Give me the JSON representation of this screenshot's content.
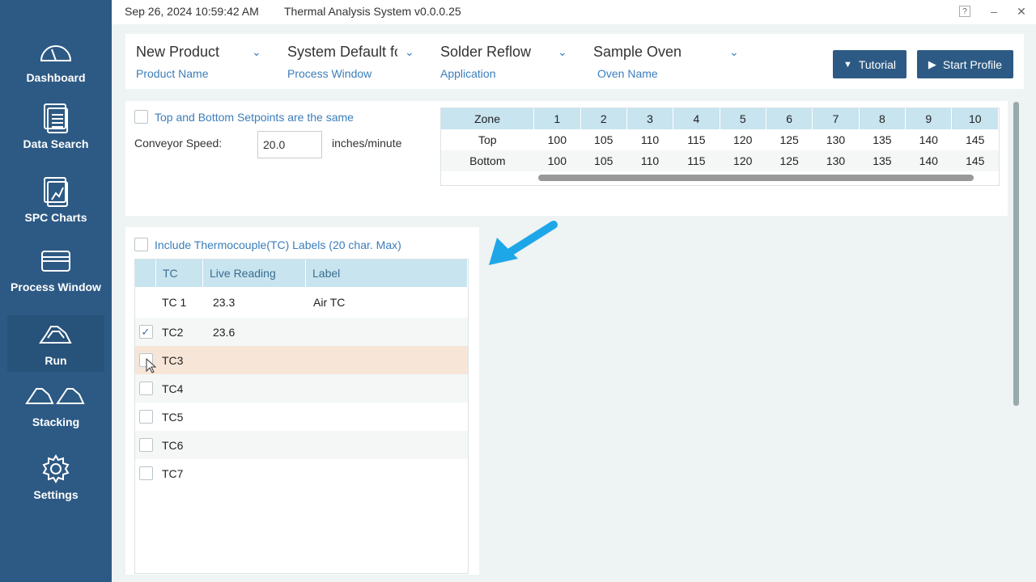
{
  "window": {
    "datetime": "Sep 26, 2024 10:59:42 AM",
    "title": "Thermal Analysis System v0.0.0.25",
    "help_label": "?",
    "minimize_label": "–",
    "close_label": "✕"
  },
  "sidebar": {
    "items": [
      {
        "label": "Dashboard",
        "icon": "gauge-icon"
      },
      {
        "label": "Data Search",
        "icon": "documents-icon"
      },
      {
        "label": "SPC Charts",
        "icon": "chart-clipboard-icon"
      },
      {
        "label": "Process Window",
        "icon": "window-icon"
      },
      {
        "label": "Run",
        "icon": "profile-icon",
        "active": true
      },
      {
        "label": "Stacking",
        "icon": "stacking-icon"
      },
      {
        "label": "Settings",
        "icon": "gear-icon"
      }
    ]
  },
  "header": {
    "product": {
      "value": "New Product",
      "label": "Product Name"
    },
    "process_window": {
      "value": "System Default fo",
      "label": "Process Window"
    },
    "application": {
      "value": "Solder Reflow",
      "label": "Application"
    },
    "oven": {
      "value": "Sample Oven",
      "label": "Oven Name"
    },
    "tutorial_label": "Tutorial",
    "start_label": "Start Profile"
  },
  "setpoints": {
    "same_label": "Top and Bottom Setpoints are the same",
    "same_checked": false,
    "conveyor_label": "Conveyor Speed:",
    "conveyor_value": "20.0",
    "conveyor_unit": "inches/minute",
    "zone_table": {
      "header": [
        "Zone",
        "1",
        "2",
        "3",
        "4",
        "5",
        "6",
        "7",
        "8",
        "9",
        "10"
      ],
      "rows": [
        [
          "Top",
          "100",
          "105",
          "110",
          "115",
          "120",
          "125",
          "130",
          "135",
          "140",
          "145"
        ],
        [
          "Bottom",
          "100",
          "105",
          "110",
          "115",
          "120",
          "125",
          "130",
          "135",
          "140",
          "145"
        ]
      ]
    }
  },
  "tc": {
    "include_label": "Include Thermocouple(TC)  Labels (20 char. Max)",
    "columns": [
      "TC",
      "Live Reading",
      "Label"
    ],
    "rows": [
      {
        "tc": "TC 1",
        "reading": "23.3",
        "label": "Air TC",
        "checkbox": false,
        "checked": false
      },
      {
        "tc": "TC2",
        "reading": "23.6",
        "label": "",
        "checkbox": true,
        "checked": true
      },
      {
        "tc": "TC3",
        "reading": "",
        "label": "",
        "checkbox": true,
        "checked": false,
        "hover": true
      },
      {
        "tc": "TC4",
        "reading": "",
        "label": "",
        "checkbox": true,
        "checked": false
      },
      {
        "tc": "TC5",
        "reading": "",
        "label": "",
        "checkbox": true,
        "checked": false
      },
      {
        "tc": "TC6",
        "reading": "",
        "label": "",
        "checkbox": true,
        "checked": false
      },
      {
        "tc": "TC7",
        "reading": "",
        "label": "",
        "checkbox": true,
        "checked": false
      }
    ]
  },
  "colors": {
    "sidebar": "#2d5a84",
    "accent": "#3b7dbb",
    "table_header": "#c7e4ef",
    "hover_row": "#f7e6d8",
    "arrow": "#1ea7e8"
  }
}
